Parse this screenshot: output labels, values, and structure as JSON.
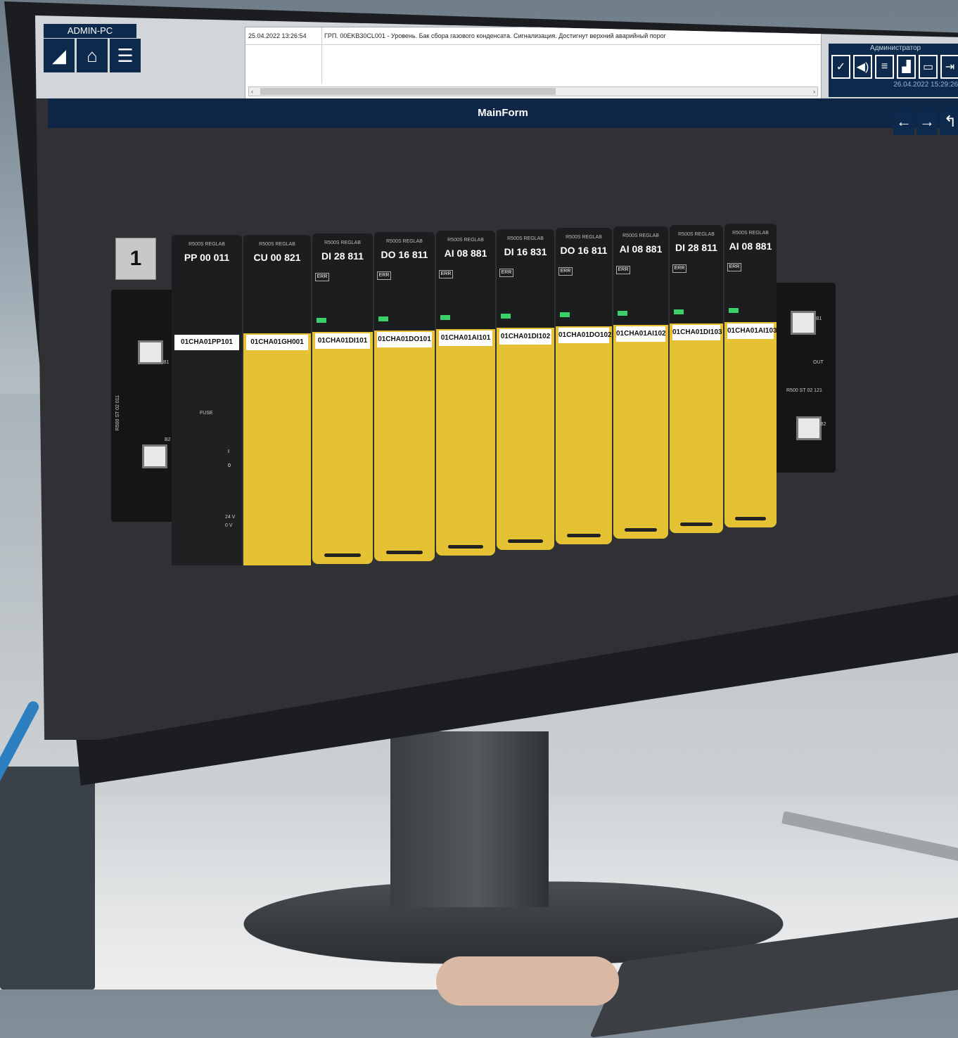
{
  "pc_name": "ADMIN-PC",
  "alarm_log": {
    "time": "25.04.2022 13:26:54",
    "message": "ГРП. 00EKB30CL001 - Уровень. Бак сбора газового конденсата. Сигнализация. Достигнут верхний аварийный порог"
  },
  "user": {
    "role": "Администратор",
    "datetime": "26.04.2022 15:29:26"
  },
  "window_title": "MainForm",
  "rack_number": "1",
  "modules": [
    {
      "type": "PP 00 011",
      "tag": "01CHA01PP101",
      "kind": "power"
    },
    {
      "type": "CU 00 821",
      "tag": "01CHA01GH001",
      "kind": "cpu"
    },
    {
      "type": "DI 28 811",
      "tag": "01CHA01DI101",
      "kind": "io"
    },
    {
      "type": "DO 16 811",
      "tag": "01CHA01DO101",
      "kind": "io"
    },
    {
      "type": "AI 08 881",
      "tag": "01CHA01AI101",
      "kind": "io"
    },
    {
      "type": "DI 16 831",
      "tag": "01CHA01DI102",
      "kind": "io"
    },
    {
      "type": "DO 16 811",
      "tag": "01CHA01DO102",
      "kind": "io"
    },
    {
      "type": "AI 08 881",
      "tag": "01CHA01AI102",
      "kind": "io"
    },
    {
      "type": "DI 28 811",
      "tag": "01CHA01DI103",
      "kind": "io"
    },
    {
      "type": "AI 08 881",
      "tag": "01CHA01AI103",
      "kind": "io"
    }
  ],
  "module_brand": "R500S REGLAB",
  "labels": {
    "err": "ERR",
    "fuse": "FUSE",
    "v24": "24 V",
    "v0": "0 V",
    "left_bus": "R500 ST 02 011",
    "right_bus": "R500 ST 02 121",
    "b1": "B1",
    "b2": "B2",
    "out": "OUT",
    "power_on": "I",
    "power_off": "0"
  },
  "colors": {
    "header_navy": "#0f2646",
    "module_yellow": "#e4c233",
    "led_green": "#3bd06a"
  }
}
